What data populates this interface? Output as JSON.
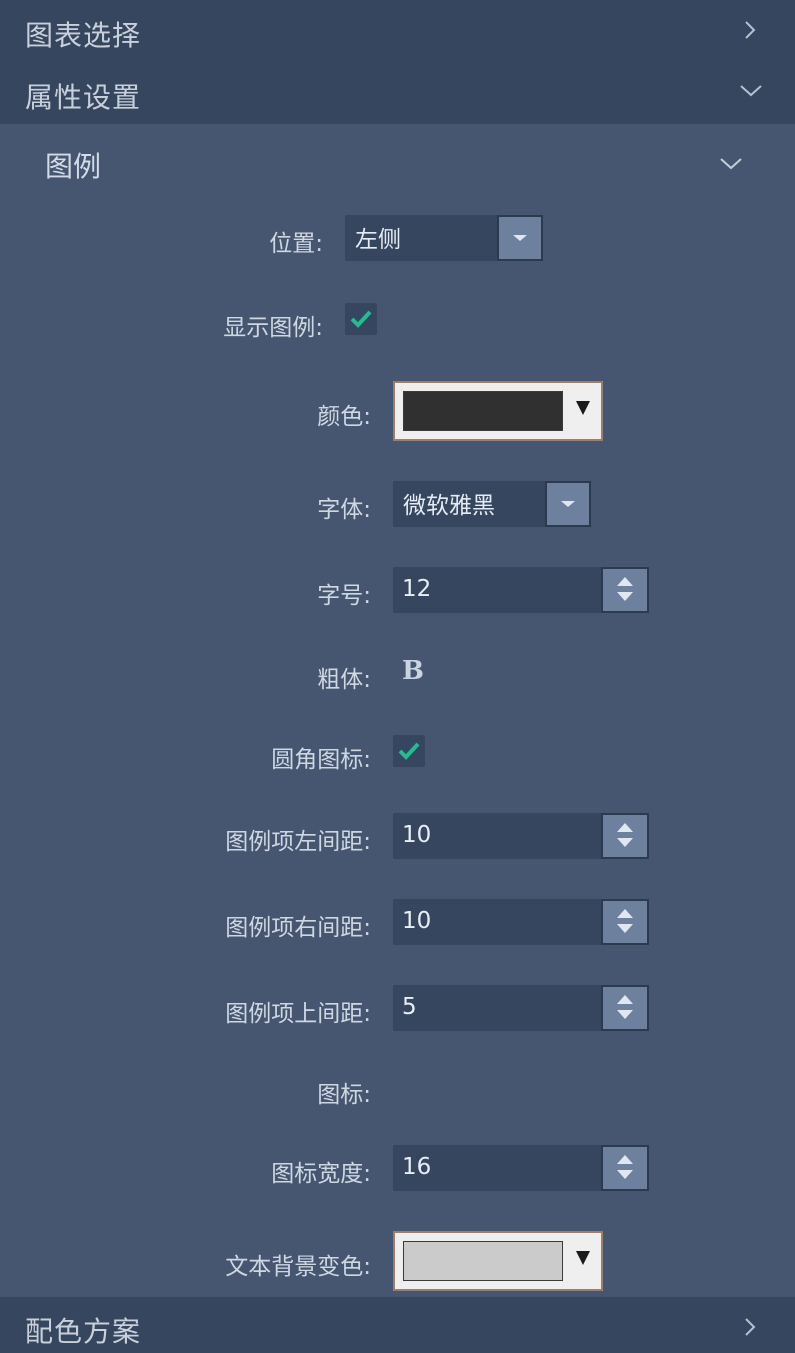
{
  "sections": {
    "chart_select": {
      "title": "图表选择"
    },
    "property_settings": {
      "title": "属性设置"
    },
    "color_scheme": {
      "title": "配色方案"
    }
  },
  "legend_group": {
    "title": "图例",
    "position": {
      "label": "位置:",
      "value": "左侧"
    },
    "show_legend": {
      "label": "显示图例:",
      "checked": true
    },
    "color": {
      "label": "颜色:",
      "swatch": "#303030"
    },
    "font": {
      "label": "字体:",
      "value": "微软雅黑"
    },
    "font_size": {
      "label": "字号:",
      "value": "12"
    },
    "bold": {
      "label": "粗体:",
      "glyph": "B"
    },
    "rounded_icon": {
      "label": "圆角图标:",
      "checked": true
    },
    "item_left_spacing": {
      "label": "图例项左间距:",
      "value": "10"
    },
    "item_right_spacing": {
      "label": "图例项右间距:",
      "value": "10"
    },
    "item_top_spacing": {
      "label": "图例项上间距:",
      "value": "5"
    },
    "icon": {
      "label": "图标:"
    },
    "icon_width": {
      "label": "图标宽度:",
      "value": "16"
    },
    "text_bg_color": {
      "label": "文本背景变色:",
      "swatch": "#cbcbcb"
    }
  },
  "colors": {
    "panel_bg": "#465670",
    "header_bg": "#36465e",
    "check_mark": "#1fbf8f"
  }
}
